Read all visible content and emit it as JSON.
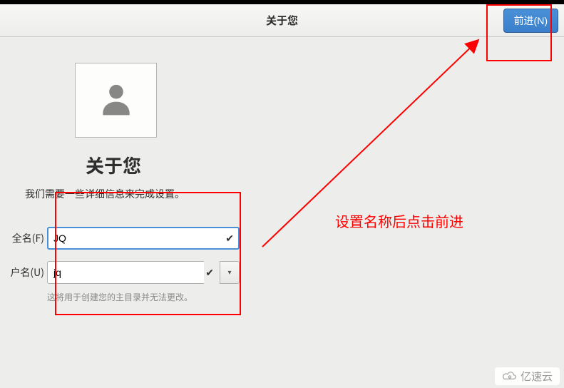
{
  "header": {
    "title": "关于您",
    "next_label": "前进(N)"
  },
  "section": {
    "title": "关于您",
    "subtitle": "我们需要一些详细信息来完成设置。"
  },
  "form": {
    "fullname_label": "全名(F)",
    "fullname_value": "JQ",
    "username_label": "户名(U)",
    "username_value": "jq",
    "hint": "这将用于创建您的主目录并无法更改。"
  },
  "annotation": {
    "text": "设置名称后点击前进"
  },
  "watermark": {
    "text": "亿速云"
  }
}
